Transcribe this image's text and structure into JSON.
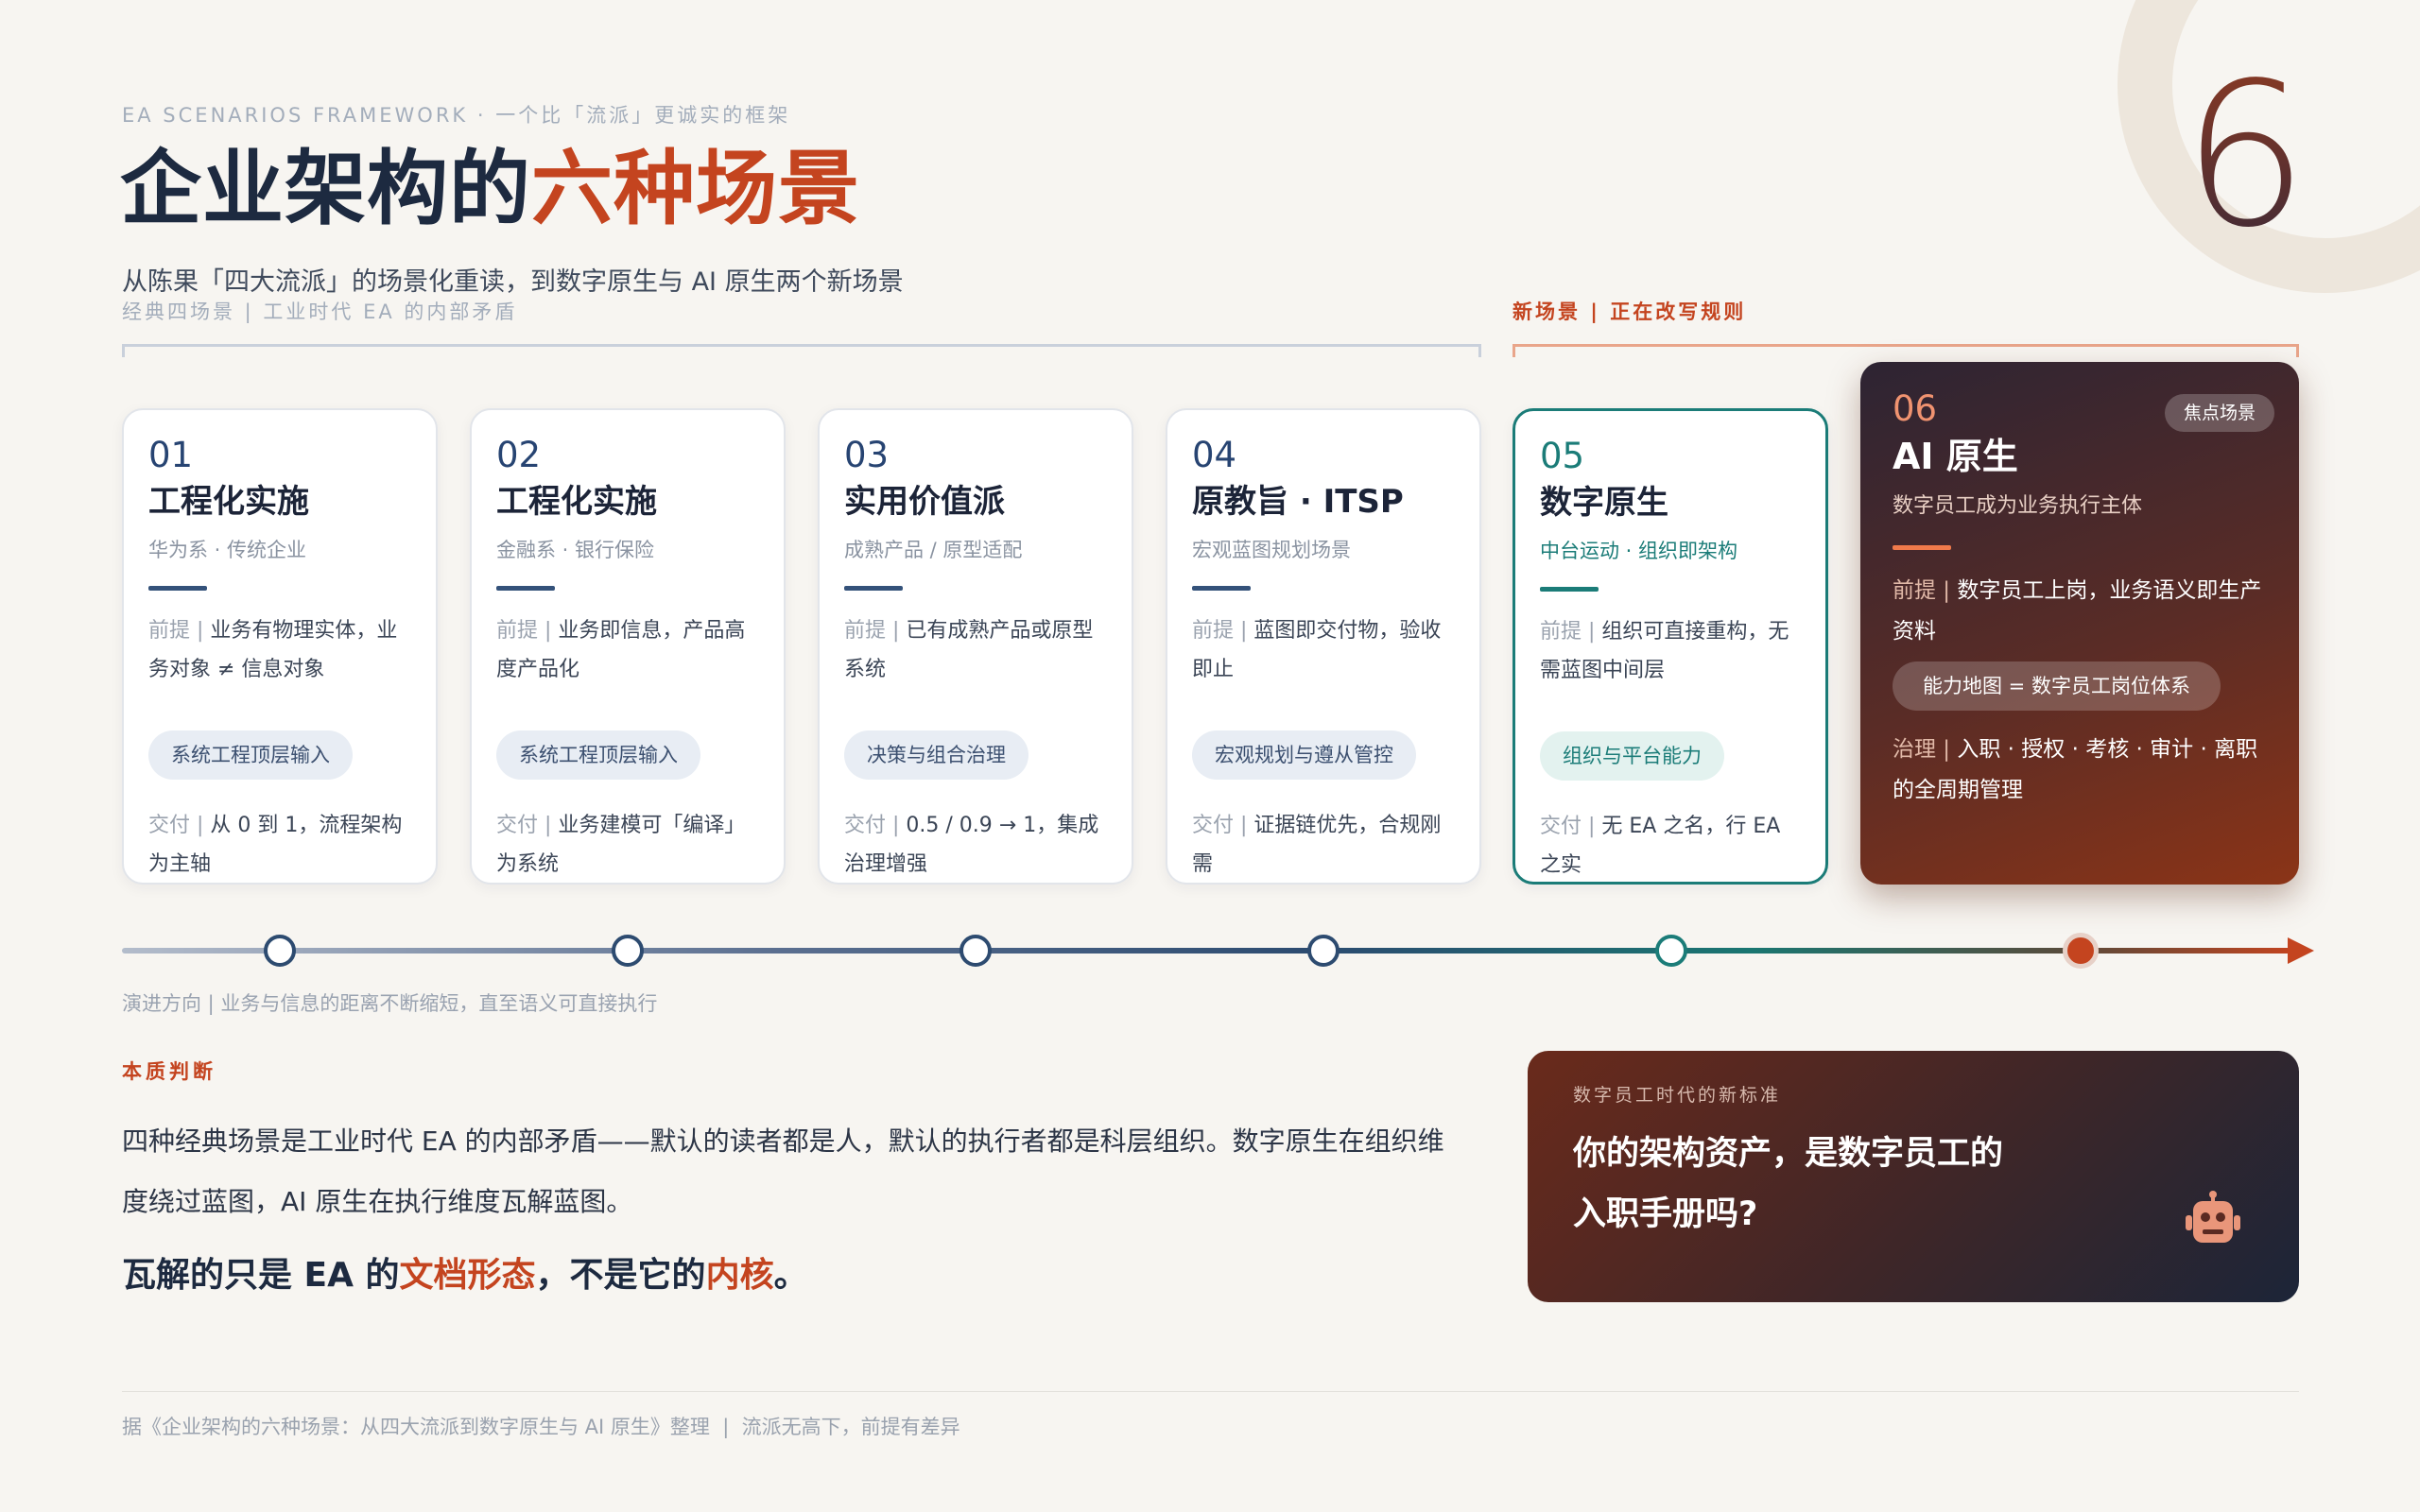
{
  "header": {
    "eyebrow": "EA SCENARIOS FRAMEWORK · 一个比「流派」更诚实的框架",
    "title_main": "企业架构的",
    "title_accent": "六种场景",
    "subtitle": "从陈果「四大流派」的场景化重读，到数字原生与 AI 原生两个新场景",
    "big_number": "6"
  },
  "groups": {
    "classic": "经典四场景 | 工业时代 EA 的内部矛盾",
    "new": "新场景 | 正在改写规则"
  },
  "scenarios": [
    {
      "num": "01",
      "name": "工程化实施",
      "tag": "华为系 · 传统企业",
      "premise_label": "前提 |",
      "premise": " 业务有物理实体，业务对象 ≠ 信息对象",
      "chip": "系统工程顶层输入",
      "deliver_label": "交付 |",
      "deliver": " 从 0 到 1，流程架构为主轴"
    },
    {
      "num": "02",
      "name": "工程化实施",
      "tag": "金融系 · 银行保险",
      "premise_label": "前提 |",
      "premise": " 业务即信息，产品高度产品化",
      "chip": "系统工程顶层输入",
      "deliver_label": "交付 |",
      "deliver": " 业务建模可「编译」为系统"
    },
    {
      "num": "03",
      "name": "实用价值派",
      "tag": "成熟产品 / 原型适配",
      "premise_label": "前提 |",
      "premise": " 已有成熟产品或原型系统",
      "chip": "决策与组合治理",
      "deliver_label": "交付 |",
      "deliver": " 0.5 / 0.9 → 1，集成治理增强"
    },
    {
      "num": "04",
      "name": "原教旨 · ITSP",
      "tag": "宏观蓝图规划场景",
      "premise_label": "前提 |",
      "premise": " 蓝图即交付物，验收即止",
      "chip": "宏观规划与遵从管控",
      "deliver_label": "交付 |",
      "deliver": " 证据链优先，合规刚需"
    },
    {
      "num": "05",
      "name": "数字原生",
      "tag": "中台运动 · 组织即架构",
      "premise_label": "前提 |",
      "premise": " 组织可直接重构，无需蓝图中间层",
      "chip": "组织与平台能力",
      "deliver_label": "交付 |",
      "deliver": " 无 EA 之名，行 EA 之实"
    }
  ],
  "focus": {
    "num": "06",
    "badge": "焦点场景",
    "name": "AI 原生",
    "tag": "数字员工成为业务执行主体",
    "premise_label": "前提 |",
    "premise": " 数字员工上岗，业务语义即生产资料",
    "chip": "能力地图 = 数字员工岗位体系",
    "govern_label": "治理 |",
    "govern": " 入职 · 授权 · 考核 · 审计 · 离职的全周期管理"
  },
  "timeline": {
    "caption": "演进方向 | 业务与信息的距离不断缩短，直至语义可直接执行"
  },
  "essence": {
    "label": "本质判断",
    "body": "四种经典场景是工业时代 EA 的内部矛盾——默认的读者都是人，默认的执行者都是科层组织。数字原生在组织维度绕过蓝图，AI 原生在执行维度瓦解蓝图。",
    "c1": "瓦解的只是 EA 的",
    "c2": "文档形态",
    "c3": "，不是它的",
    "c4": "内核",
    "c5": "。"
  },
  "callout": {
    "eyebrow": "数字员工时代的新标准",
    "line1": "你的架构资产，是数字员工的",
    "line2": "入职手册吗?",
    "icon": "robot-icon"
  },
  "footer": "据《企业架构的六种场景：从四大流派到数字原生与 AI 原生》整理  |  流派无高下，前提有差异",
  "colors": {
    "accent": "#c4441f",
    "navy": "#1d2a40",
    "teal": "#1b7c78",
    "background": "#f7f5f1"
  }
}
